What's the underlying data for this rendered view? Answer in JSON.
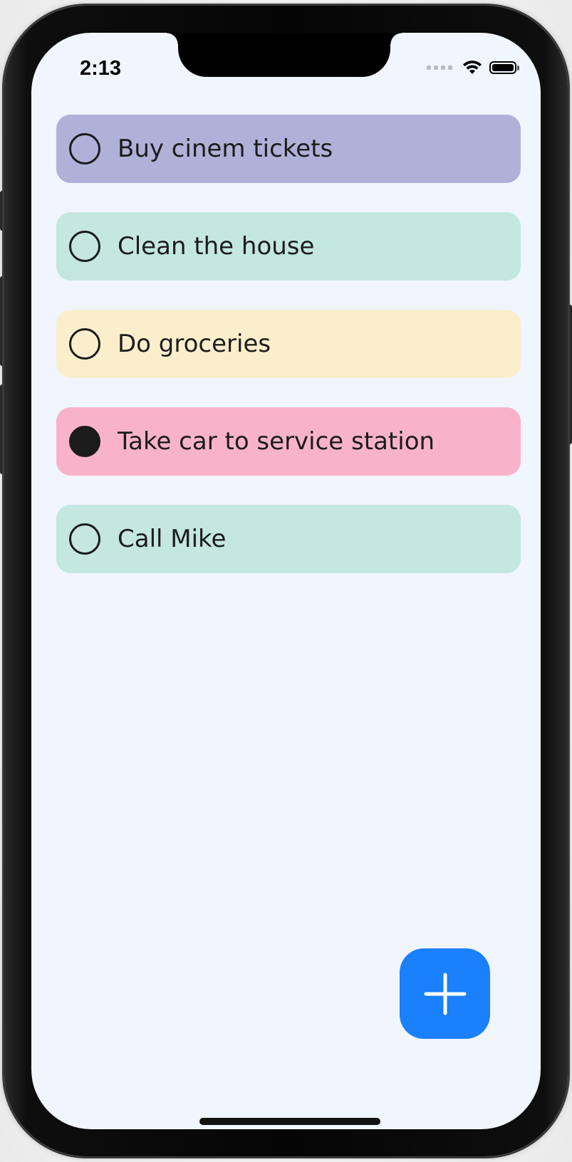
{
  "status_bar": {
    "time": "2:13",
    "wifi_icon": "wifi-icon",
    "battery_icon": "battery-icon"
  },
  "tasks": [
    {
      "label": "Buy cinem tickets",
      "completed": false,
      "color": "#b0b1d8"
    },
    {
      "label": "Clean the house",
      "completed": false,
      "color": "#c4e7df"
    },
    {
      "label": "Do groceries",
      "completed": false,
      "color": "#fbefcb"
    },
    {
      "label": "Take car to service station",
      "completed": true,
      "color": "#f8b3cb"
    },
    {
      "label": "Call Mike",
      "completed": false,
      "color": "#c4e7df"
    }
  ],
  "add_button": {
    "icon": "plus-icon",
    "color": "#1a80fb"
  },
  "theme": {
    "screen_background": "#f0f5fe"
  }
}
